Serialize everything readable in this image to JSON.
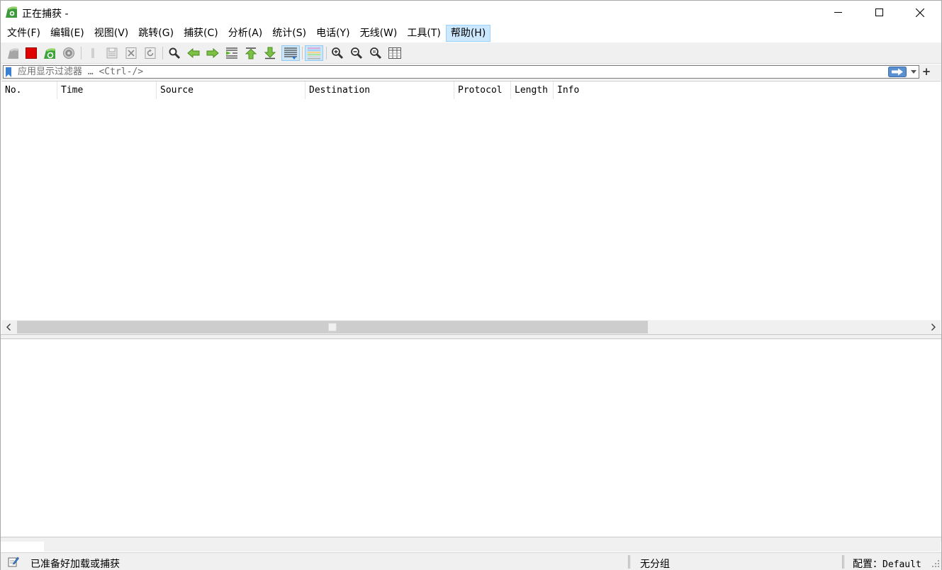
{
  "window": {
    "title": "正在捕获 -",
    "controls": [
      "minimize-icon",
      "maximize-icon",
      "close-icon"
    ]
  },
  "menu": {
    "items": [
      {
        "label": "文件(F)"
      },
      {
        "label": "编辑(E)"
      },
      {
        "label": "视图(V)"
      },
      {
        "label": "跳转(G)"
      },
      {
        "label": "捕获(C)"
      },
      {
        "label": "分析(A)"
      },
      {
        "label": "统计(S)"
      },
      {
        "label": "电话(Y)"
      },
      {
        "label": "无线(W)"
      },
      {
        "label": "工具(T)"
      },
      {
        "label": "帮助(H)"
      }
    ]
  },
  "toolbar": {
    "icons": [
      "shark-fin-start-icon",
      "stop-capture-icon",
      "restart-capture-icon",
      "capture-options-icon",
      "open-file-icon",
      "save-file-icon",
      "close-file-icon",
      "reload-file-icon",
      "find-packet-icon",
      "go-back-icon",
      "go-forward-icon",
      "go-to-packet-icon",
      "go-first-icon",
      "go-last-icon",
      "autoscroll-icon",
      "colorize-icon",
      "zoom-in-icon",
      "zoom-out-icon",
      "zoom-normal-icon",
      "resize-columns-icon"
    ],
    "accent": "#60b832"
  },
  "filter": {
    "placeholder": "应用显示过滤器 … <Ctrl-/>",
    "value": "",
    "add_label": "+"
  },
  "packet_list": {
    "columns": [
      "No.",
      "Time",
      "Source",
      "Destination",
      "Protocol",
      "Length",
      "Info"
    ],
    "rows": []
  },
  "status": {
    "ready_text": "已准备好加载或捕获",
    "packets_text": "无分组",
    "profile_label": "配置：",
    "profile_value": "Default"
  }
}
